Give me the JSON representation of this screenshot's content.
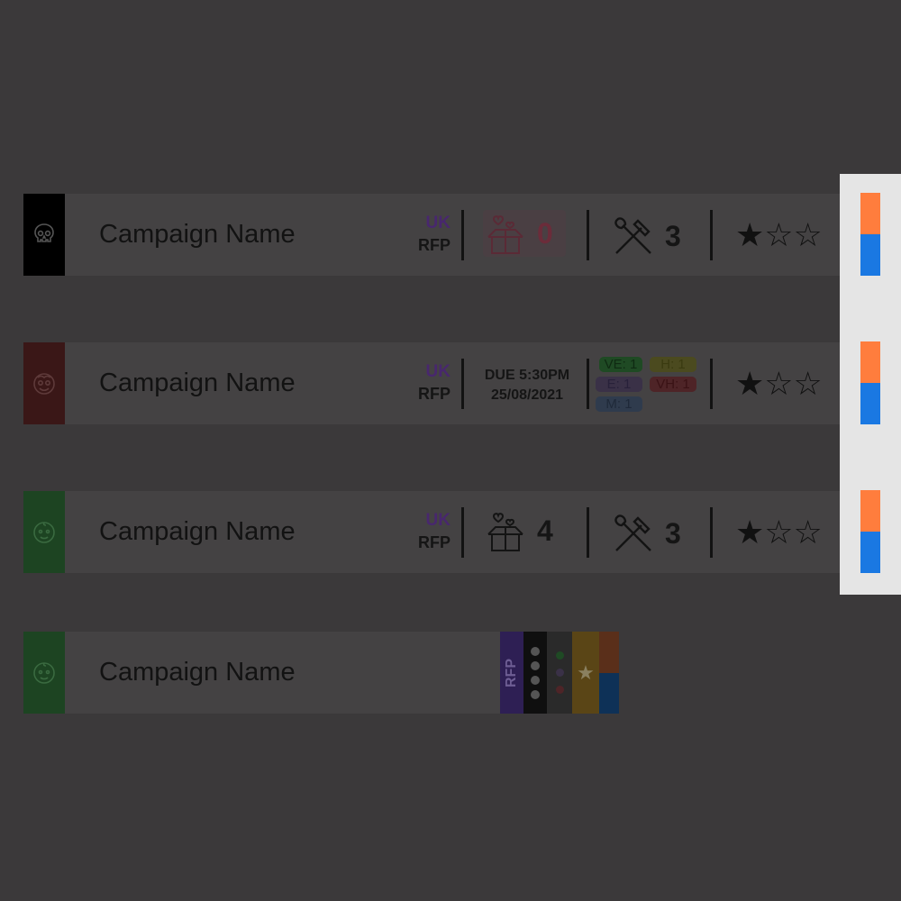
{
  "rows": [
    {
      "name": "Campaign Name",
      "icon": "skull-icon",
      "accent": "#000000",
      "country": "UK",
      "type": "RFP",
      "gifts": "0",
      "gift_color": "#6b2c3a",
      "tools": "3",
      "rating": "★☆☆"
    },
    {
      "name": "Campaign Name",
      "icon": "old-man-face-icon",
      "accent": "#3a1717",
      "country": "UK",
      "type": "RFP",
      "due_line1": "DUE 5:30PM",
      "due_line2": "25/08/2021",
      "chips": {
        "ve": "VE: 1",
        "h": "H: 1",
        "e": "E: 1",
        "vh": "VH: 1",
        "m": "M: 1"
      },
      "rating": "★☆☆"
    },
    {
      "name": "Campaign Name",
      "icon": "baby-face-icon",
      "accent": "#1d4422",
      "country": "UK",
      "type": "RFP",
      "gifts": "4",
      "tools": "3",
      "rating": "★☆☆"
    },
    {
      "name": "Campaign Name",
      "icon": "baby-face-icon",
      "accent": "#1d4422",
      "mini_label": "RFP",
      "mini_star": "★"
    }
  ],
  "colors": {
    "bg": "#3b393a",
    "row": "#444243",
    "flag_top": "#ff7d3d",
    "flag_bottom": "#1a78e2",
    "panel": "#e5e5e5"
  }
}
